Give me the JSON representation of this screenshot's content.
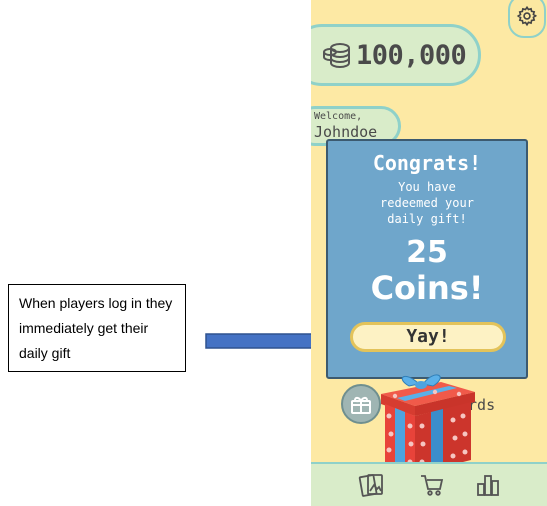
{
  "annotation": {
    "text": "When players log in they immediately get their daily gift"
  },
  "app": {
    "coins": {
      "amount": "100,000",
      "icon": "coin-stack-icon"
    },
    "settings": {
      "icon": "gear-icon"
    },
    "welcome": {
      "label": "Welcome,",
      "username": "Johndoe"
    },
    "rewards": {
      "label": "Rewards",
      "visible_fragment": "ards",
      "icon": "gift-icon"
    },
    "modal": {
      "title": "Congrats!",
      "subtitle": "You have redeemed your daily gift!",
      "amount": "25",
      "unit": "Coins!",
      "button_label": "Yay!"
    },
    "bottom_nav": [
      {
        "icon": "cards-icon"
      },
      {
        "icon": "cart-icon"
      },
      {
        "icon": "leaderboard-icon"
      }
    ],
    "colors": {
      "background": "#fde9a4",
      "pill": "#d9ecc9",
      "pill_border": "#8fd1c9",
      "modal": "#6fa6cb",
      "button": "#fdf2c4",
      "gift_box": "#e8433a",
      "ribbon": "#4ea3df"
    }
  }
}
